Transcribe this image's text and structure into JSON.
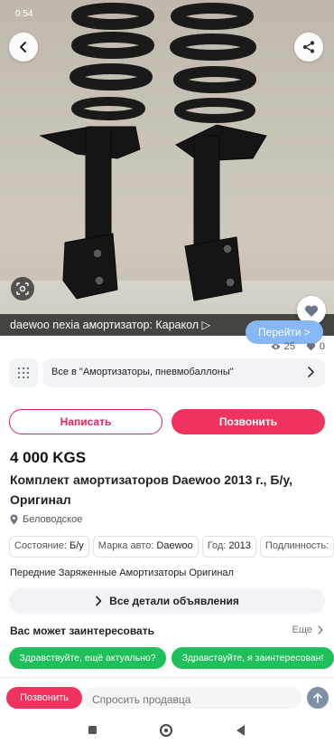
{
  "status_bar": {
    "time": "0:54",
    "right": ""
  },
  "photo": {
    "ad_text": "daewoo nexia амортизатор: Каракол ▷",
    "ad_button": "Перейти >"
  },
  "stats": {
    "views": "25",
    "favorites": "0"
  },
  "category": {
    "label": "Все в \"Амортизаторы, пневмобаллоны\""
  },
  "actions": {
    "write": "Написать",
    "call": "Позвонить"
  },
  "listing": {
    "price": "4 000 KGS",
    "title": "Комплект амортизаторов Daewoo 2013 г., Б/у, Оригинал",
    "location": "Беловодское",
    "chips": [
      {
        "key": "Состояние:",
        "value": "Б/у"
      },
      {
        "key": "Марка авто:",
        "value": "Daewoo"
      },
      {
        "key": "Год:",
        "value": "2013"
      },
      {
        "key": "Подлинность:",
        "value": ""
      }
    ],
    "description": "Передние Заряженные Амортизаторы Оригинал",
    "details_button": "Все детали объявления"
  },
  "interest": {
    "title": "Вас может заинтересовать",
    "more": "Еще"
  },
  "quick_replies": [
    "Здравствуйте, ещё актуально?",
    "Здравствуйте, я заинтересован!"
  ],
  "bottom_bar": {
    "call": "Позвонить",
    "input_placeholder": "Спросить продавца"
  },
  "colors": {
    "accent": "#f0325f",
    "quick_reply": "#1fbf5b",
    "chip_border": "#e2e3e8"
  }
}
